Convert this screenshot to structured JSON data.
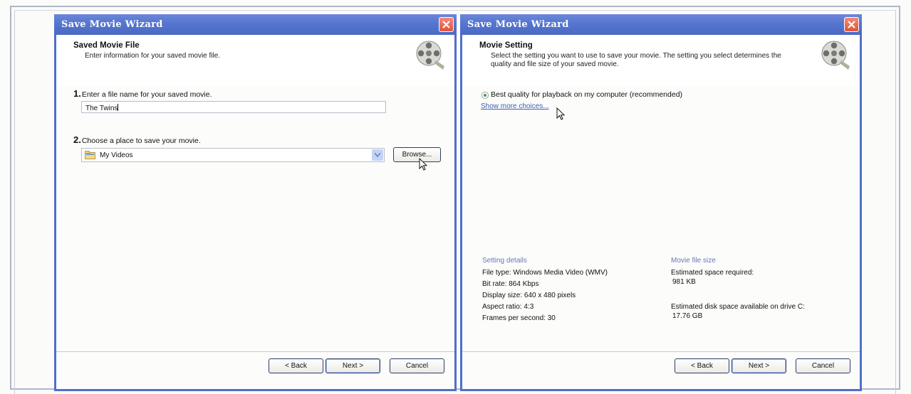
{
  "left_window": {
    "title": "Save Movie Wizard",
    "header_title": "Saved Movie File",
    "header_desc": "Enter information for your saved movie file.",
    "step1_num": "1.",
    "step1_label": "Enter a file name for your saved movie.",
    "filename_value": "The Twins",
    "step2_num": "2.",
    "step2_label": "Choose a place to save your movie.",
    "location_value": "My Videos",
    "browse_label": "Browse...",
    "back_label": "< Back",
    "next_label": "Next >",
    "cancel_label": "Cancel"
  },
  "right_window": {
    "title": "Save Movie Wizard",
    "header_title": "Movie Setting",
    "header_desc": "Select the setting you want to use to save your movie. The setting you select determines the quality and file size of your saved movie.",
    "option_label": "Best quality for playback on my computer (recommended)",
    "more_link": "Show more choices...",
    "setting_details": {
      "heading": "Setting details",
      "file_type": "File type: Windows Media Video (WMV)",
      "bit_rate": "Bit rate: 864 Kbps",
      "display_size": "Display size: 640 x 480 pixels",
      "aspect_ratio": "Aspect ratio: 4:3",
      "fps": "Frames per second: 30"
    },
    "file_size": {
      "heading": "Movie file size",
      "space_label": "Estimated space required:",
      "space_value": "981 KB",
      "disk_label": "Estimated disk space available on drive C:",
      "disk_value": "17.76 GB"
    },
    "back_label": "< Back",
    "next_label": "Next >",
    "cancel_label": "Cancel"
  },
  "icons": [
    "close-icon",
    "film-reel-icon",
    "folder-icon",
    "dropdown-arrow-icon",
    "mouse-pointer-icon"
  ],
  "colors": {
    "titlebar": "#5575cf",
    "close": "#e0533d",
    "link": "#3d5fb0",
    "section_head": "#6778b6"
  }
}
